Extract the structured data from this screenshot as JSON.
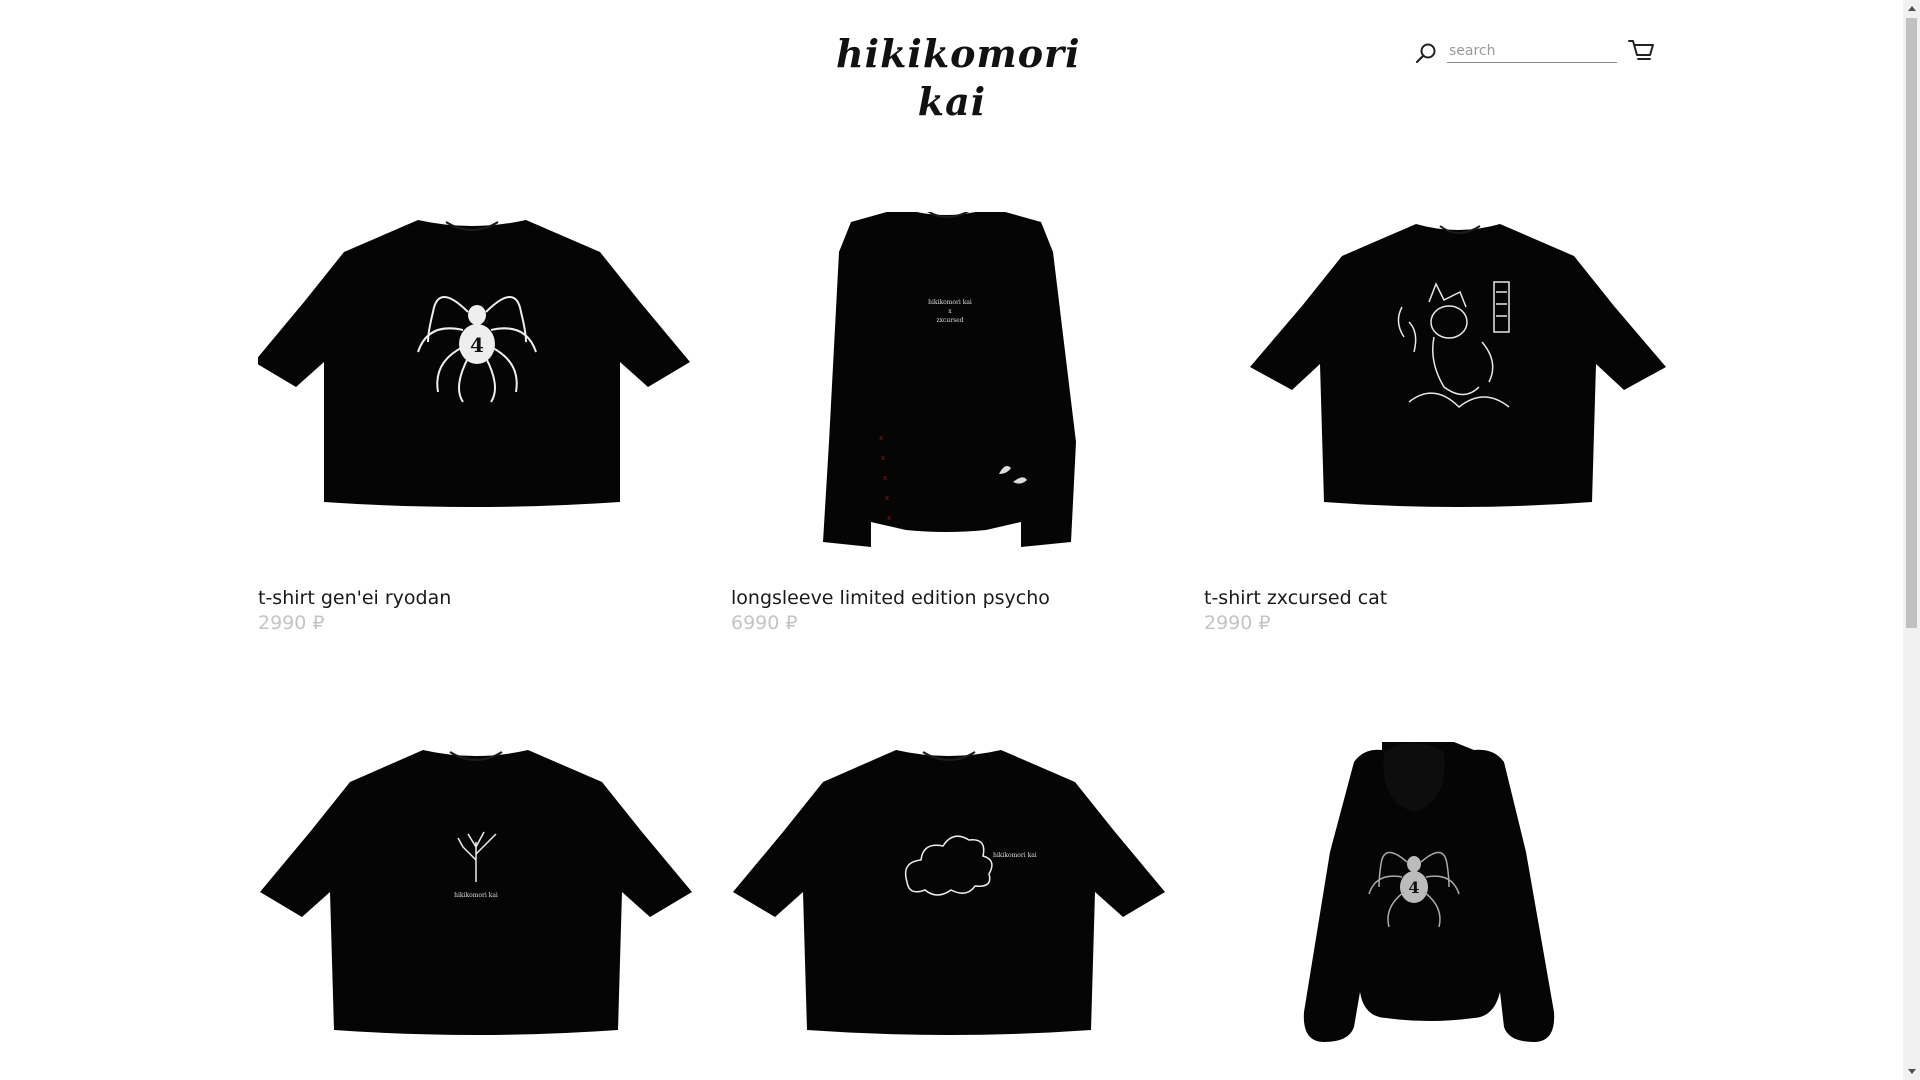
{
  "header": {
    "logo": "hikikomori kai",
    "search": {
      "placeholder": "search",
      "value": ""
    },
    "icons": {
      "search": "search-icon",
      "cart": "cart-icon"
    }
  },
  "products": [
    {
      "title": "t-shirt gen'ei ryodan",
      "price": "2990 ₽",
      "print": "spider 4"
    },
    {
      "title": "longsleeve limited edition psycho",
      "price": "6990 ₽",
      "print": "hikikomori kai x zxcursed"
    },
    {
      "title": "t-shirt zxcursed cat",
      "price": "2990 ₽",
      "print": "cat illustration"
    },
    {
      "title": "",
      "price": "",
      "print": "tree hikikomori kai"
    },
    {
      "title": "",
      "price": "",
      "print": "cloud hikikomori kai"
    },
    {
      "title": "",
      "price": "",
      "print": "hoodie spider 4"
    }
  ],
  "prints": {
    "longsleeve": [
      "hikikomori kai",
      "x",
      "zxcursed"
    ],
    "tree": "hikikomori kai",
    "cloud": "hikikomori kai"
  },
  "colors": {
    "text": "#1a1a1a",
    "price": "#c4c4c4",
    "garment": "#050505",
    "background": "#ffffff"
  }
}
